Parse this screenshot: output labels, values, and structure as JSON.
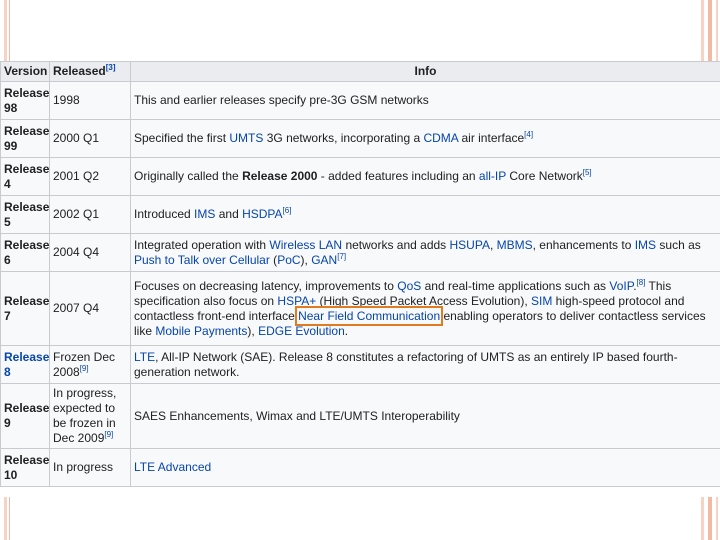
{
  "table": {
    "headers": {
      "version": "Version",
      "released": "Released",
      "released_ref": "[3]",
      "info": "Info"
    },
    "rows": [
      {
        "version_line1": "Release",
        "version_line2": "98",
        "released": "1998",
        "info_parts": [
          {
            "t": "This and earlier releases specify pre-3G GSM networks",
            "s": "plain"
          }
        ]
      },
      {
        "version_line1": "Release",
        "version_line2": "99",
        "released": "2000 Q1",
        "info_parts": [
          {
            "t": "Specified the first ",
            "s": "plain"
          },
          {
            "t": "UMTS",
            "s": "link"
          },
          {
            "t": " 3G networks, incorporating a ",
            "s": "plain"
          },
          {
            "t": "CDMA",
            "s": "link"
          },
          {
            "t": " air interface",
            "s": "plain"
          },
          {
            "t": "[4]",
            "s": "sup"
          }
        ]
      },
      {
        "version_line1": "Release",
        "version_line2": "4",
        "released": "2001 Q2",
        "info_parts": [
          {
            "t": "Originally called the ",
            "s": "plain"
          },
          {
            "t": "Release 2000",
            "s": "bold"
          },
          {
            "t": " - added features including an ",
            "s": "plain"
          },
          {
            "t": "all-IP",
            "s": "link"
          },
          {
            "t": " Core Network",
            "s": "plain"
          },
          {
            "t": "[5]",
            "s": "sup"
          }
        ]
      },
      {
        "version_line1": "Release",
        "version_line2": "5",
        "released": "2002 Q1",
        "info_parts": [
          {
            "t": "Introduced ",
            "s": "plain"
          },
          {
            "t": "IMS",
            "s": "link"
          },
          {
            "t": " and ",
            "s": "plain"
          },
          {
            "t": "HSDPA",
            "s": "link"
          },
          {
            "t": "[6]",
            "s": "sup"
          }
        ]
      },
      {
        "version_line1": "Release",
        "version_line2": "6",
        "released": "2004 Q4",
        "info_parts": [
          {
            "t": "Integrated operation with ",
            "s": "plain"
          },
          {
            "t": "Wireless LAN",
            "s": "link"
          },
          {
            "t": " networks and adds ",
            "s": "plain"
          },
          {
            "t": "HSUPA",
            "s": "link"
          },
          {
            "t": ", ",
            "s": "plain"
          },
          {
            "t": "MBMS",
            "s": "link"
          },
          {
            "t": ", enhancements to ",
            "s": "plain"
          },
          {
            "t": "IMS",
            "s": "link"
          },
          {
            "t": " such as ",
            "s": "plain"
          },
          {
            "t": "Push to Talk over Cellular",
            "s": "link"
          },
          {
            "t": " (",
            "s": "plain"
          },
          {
            "t": "PoC",
            "s": "link"
          },
          {
            "t": "), ",
            "s": "plain"
          },
          {
            "t": "GAN",
            "s": "link"
          },
          {
            "t": "[7]",
            "s": "sup"
          }
        ]
      },
      {
        "version_line1": "Release",
        "version_line2": "7",
        "released": "2007 Q4",
        "info_parts": [
          {
            "t": "Focuses on decreasing latency, improvements to ",
            "s": "plain"
          },
          {
            "t": "QoS",
            "s": "link"
          },
          {
            "t": " and real-time applications such as ",
            "s": "plain"
          },
          {
            "t": "VoIP",
            "s": "link"
          },
          {
            "t": ".",
            "s": "plain"
          },
          {
            "t": "[8]",
            "s": "sup"
          },
          {
            "t": " This specification also focus on ",
            "s": "plain"
          },
          {
            "t": "HSPA+",
            "s": "link"
          },
          {
            "t": " (High Speed Packet Access Evolution), ",
            "s": "plain"
          },
          {
            "t": "SIM",
            "s": "link"
          },
          {
            "t": " high-speed protocol and contactless front-end interface ",
            "s": "plain"
          },
          {
            "t": "Near Field Communication",
            "s": "highlight"
          },
          {
            "t": " enabling operators to deliver contactless services like ",
            "s": "plain"
          },
          {
            "t": "Mobile Payments",
            "s": "link"
          },
          {
            "t": "), ",
            "s": "plain"
          },
          {
            "t": "EDGE Evolution",
            "s": "link"
          },
          {
            "t": ".",
            "s": "plain"
          }
        ]
      },
      {
        "version_line1": "Release",
        "version_line2": "8",
        "version_link": true,
        "released": "Frozen Dec 2008",
        "released_ref": "[9]",
        "info_parts": [
          {
            "t": "LTE",
            "s": "link"
          },
          {
            "t": ", All-IP Network (SAE). Release 8 constitutes a refactoring of UMTS as an entirely IP based fourth-generation network.",
            "s": "plain"
          }
        ]
      },
      {
        "version_line1": "Release",
        "version_line2": "9",
        "released": "In progress, expected to be frozen in Dec 2009",
        "released_ref": "[9]",
        "info_parts": [
          {
            "t": "SAES Enhancements, Wimax and LTE/UMTS Interoperability",
            "s": "plain"
          }
        ]
      },
      {
        "version_line1": "Release",
        "version_line2": "10",
        "released": "In progress",
        "info_parts": [
          {
            "t": "LTE Advanced",
            "s": "link"
          }
        ]
      }
    ]
  }
}
